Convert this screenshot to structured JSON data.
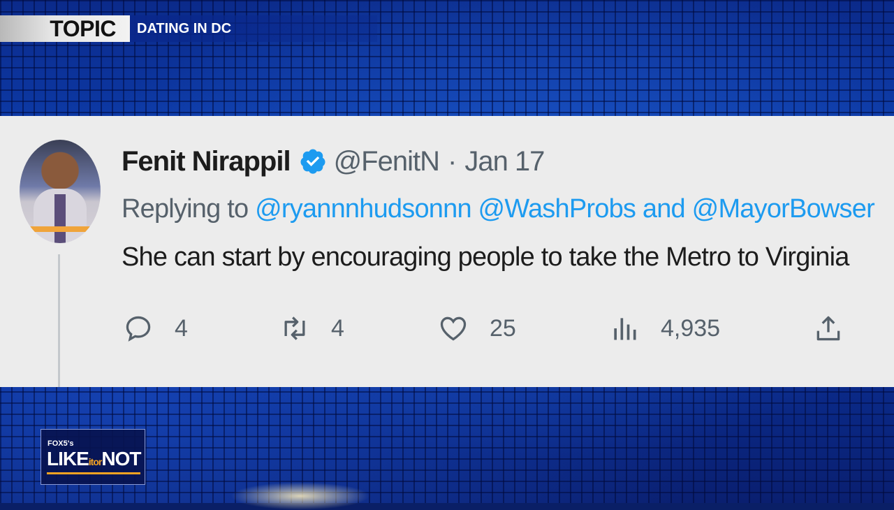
{
  "banner": {
    "topic_label": "TOPIC",
    "topic_value": "DATING IN DC"
  },
  "tweet": {
    "author_name": "Fenit Nirappil",
    "verified": true,
    "handle": "@FenitN",
    "separator": "·",
    "date": "Jan 17",
    "replying_prefix": "Replying to",
    "mentions": [
      "@ryannnhudsonnn",
      "@WashProbs",
      "@MayorBowser"
    ],
    "mention_joiner": "and",
    "text": "She can start by encouraging people to take the Metro to Virginia",
    "actions": {
      "reply_count": "4",
      "retweet_count": "4",
      "like_count": "25",
      "views_count": "4,935"
    },
    "icons": [
      "reply-icon",
      "retweet-icon",
      "like-icon",
      "views-icon",
      "share-icon"
    ]
  },
  "logo": {
    "station": "FOX5's",
    "word1": "LIKE",
    "small1": "it",
    "small2": "or",
    "word2": "NOT"
  },
  "colors": {
    "mention": "#1d9bf0",
    "verified": "#1d9bf0",
    "background": "#0b2f95",
    "card": "#ececec",
    "logo_accent": "#f4a322"
  }
}
